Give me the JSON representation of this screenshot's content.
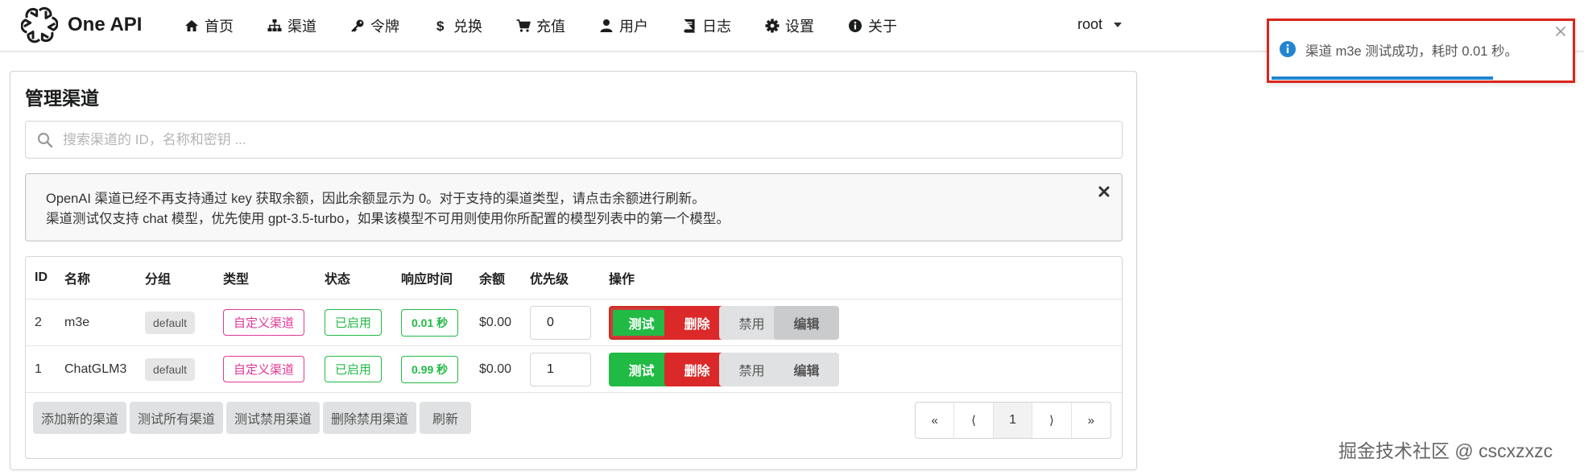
{
  "header": {
    "app_title": "One API",
    "nav": [
      {
        "label": "首页",
        "icon": "home-icon"
      },
      {
        "label": "渠道",
        "icon": "sitemap-icon"
      },
      {
        "label": "令牌",
        "icon": "key-icon"
      },
      {
        "label": "兑换",
        "icon": "dollar-icon"
      },
      {
        "label": "充值",
        "icon": "cart-icon"
      },
      {
        "label": "用户",
        "icon": "user-icon"
      },
      {
        "label": "日志",
        "icon": "book-icon"
      },
      {
        "label": "设置",
        "icon": "gear-icon"
      },
      {
        "label": "关于",
        "icon": "info-icon"
      }
    ],
    "user": "root"
  },
  "panel": {
    "title": "管理渠道",
    "search_placeholder": "搜索渠道的 ID，名称和密钥 ...",
    "notice": {
      "line1": "OpenAI 渠道已经不再支持通过 key 获取余额，因此余额显示为 0。对于支持的渠道类型，请点击余额进行刷新。",
      "line2": "渠道测试仅支持 chat 模型，优先使用 gpt-3.5-turbo，如果该模型不可用则使用你所配置的模型列表中的第一个模型。"
    }
  },
  "table": {
    "columns": [
      "ID",
      "名称",
      "分组",
      "类型",
      "状态",
      "响应时间",
      "余额",
      "优先级",
      "操作"
    ],
    "rows": [
      {
        "id": "2",
        "name": "m3e",
        "group": "default",
        "type": "自定义渠道",
        "status": "已启用",
        "response_time": "0.01 秒",
        "balance": "$0.00",
        "priority": "0"
      },
      {
        "id": "1",
        "name": "ChatGLM3",
        "group": "default",
        "type": "自定义渠道",
        "status": "已启用",
        "response_time": "0.99 秒",
        "balance": "$0.00",
        "priority": "1"
      }
    ],
    "actions": {
      "test": "测试",
      "delete": "删除",
      "disable": "禁用",
      "edit": "编辑"
    },
    "footer_buttons": {
      "add": "添加新的渠道",
      "test_all": "测试所有渠道",
      "test_disabled": "测试禁用渠道",
      "delete_disabled": "删除禁用渠道",
      "refresh": "刷新"
    },
    "pager": {
      "first": "«",
      "prev": "⟨",
      "current": "1",
      "next": "⟩",
      "last": "»"
    }
  },
  "toast": {
    "message": "渠道 m3e 测试成功，耗时 0.01 秒。"
  },
  "watermark": "掘金技术社区 @ cscxzxzc",
  "colors": {
    "green": "#21ba45",
    "red": "#db2828",
    "pink": "#e03997",
    "blue": "#2185d0",
    "highlight": "#d9271b"
  }
}
